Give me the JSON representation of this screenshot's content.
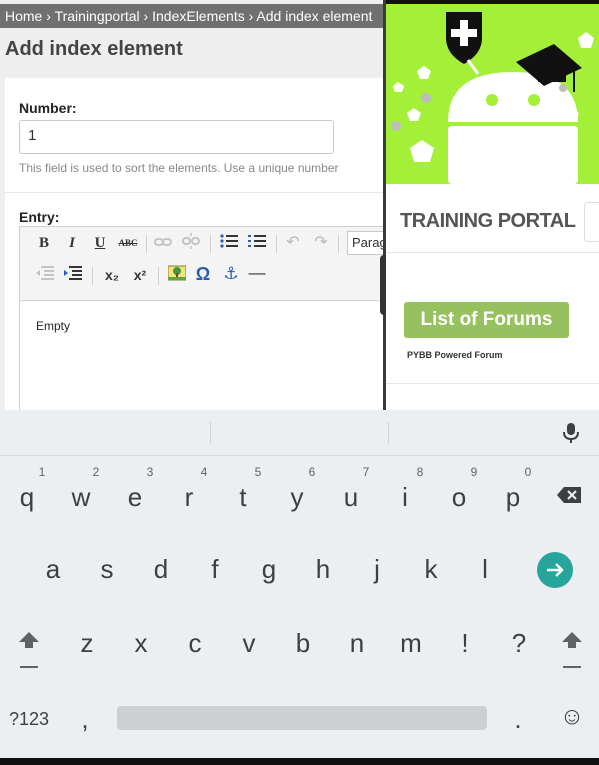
{
  "breadcrumb": {
    "items": [
      "Home",
      "Trainingportal",
      "IndexElements",
      "Add index element"
    ],
    "separator": "›"
  },
  "page_title": "Add index element",
  "form": {
    "number_label": "Number:",
    "number_value": "1",
    "number_help": "This field is used to sort the elements. Use a unique number",
    "entry_label": "Entry:",
    "editor_content": "Empty",
    "format_select_value": "Paragraph",
    "toolbar": {
      "bold": "B",
      "italic": "I",
      "underline": "U",
      "strikethrough": "ABC",
      "subscript": "x₂",
      "superscript": "x²",
      "special_char": "Ω",
      "anchor": "⚓",
      "hr": "—"
    }
  },
  "pane_controls": {
    "close": "✕",
    "resize": "◢",
    "window": "▫"
  },
  "right_pane": {
    "portal_title": "TRAINING PORTAL",
    "forums_button": "List of Forums",
    "pybb_text": "PYBB Powered Forum",
    "hero_color": "#a4f038"
  },
  "keyboard": {
    "row1": [
      "q",
      "w",
      "e",
      "r",
      "t",
      "y",
      "u",
      "i",
      "o",
      "p"
    ],
    "row1_hints": [
      "1",
      "2",
      "3",
      "4",
      "5",
      "6",
      "7",
      "8",
      "9",
      "0"
    ],
    "row2": [
      "a",
      "s",
      "d",
      "f",
      "g",
      "h",
      "j",
      "k",
      "l"
    ],
    "row3": [
      "z",
      "x",
      "c",
      "v",
      "b",
      "n",
      "m",
      "!",
      "?"
    ],
    "symbols_key": "?123",
    "comma_key": ",",
    "period_key": ".",
    "emoji_icon": "☺",
    "enter_color": "#26a69a"
  }
}
